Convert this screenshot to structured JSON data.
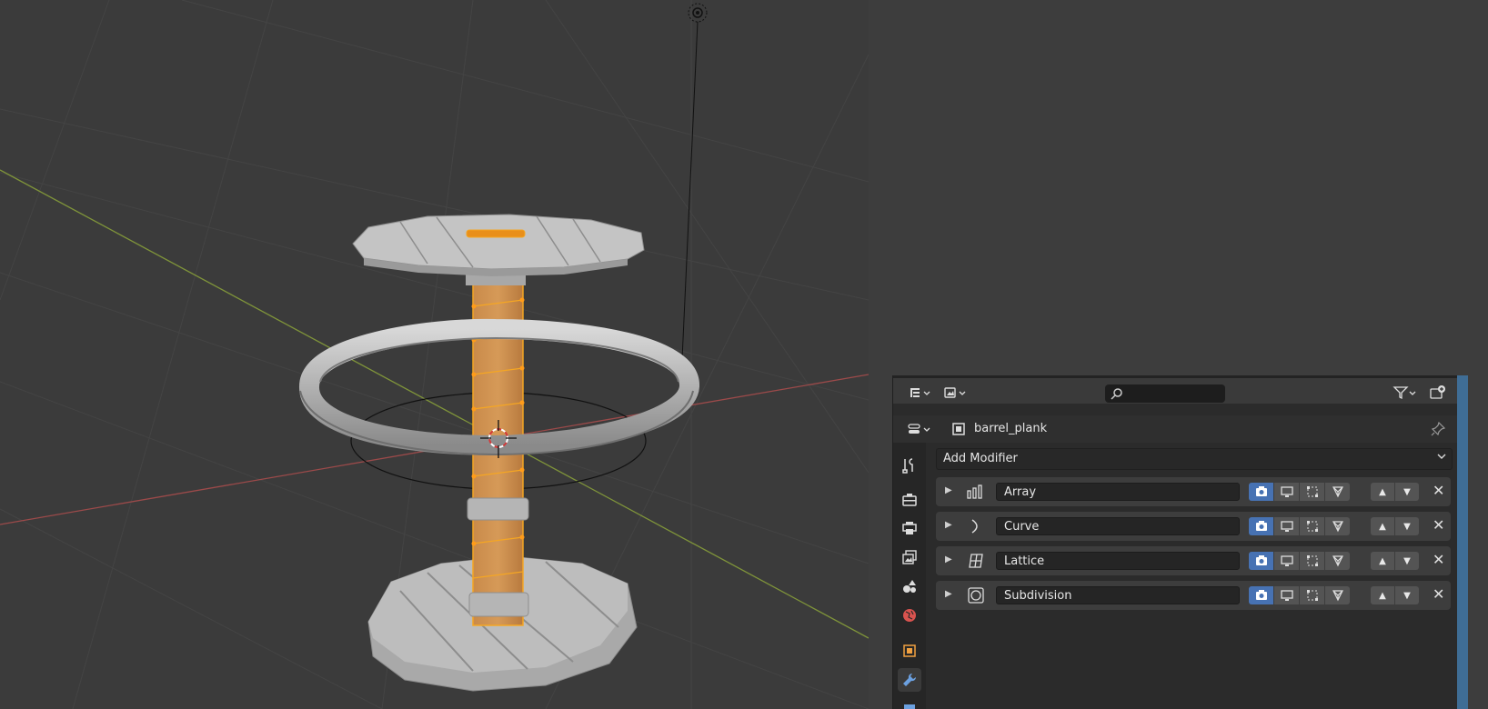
{
  "viewport": {
    "colors": {
      "background": "#3b3b3b",
      "grid": "#444444",
      "x_axis": "#9c4a4a",
      "y_axis": "#7f943a",
      "selected": "#f5a623",
      "mesh": "#b9b9b9"
    }
  },
  "properties": {
    "header": {
      "editor_type_icon": "outliner-editor-icon",
      "display_mode_icon": "display-mode-icon",
      "search": {
        "value": "",
        "placeholder": ""
      },
      "filter_icon": "filter-icon",
      "new_collection_icon": "new-collection-icon"
    },
    "object": {
      "type_icon": "object-data-icon",
      "name": "barrel_plank",
      "pin_icon": "pin-icon"
    },
    "tabs": [
      {
        "name": "tool",
        "icon": "wrench-screwdriver-icon",
        "active": false
      },
      {
        "name": "render",
        "icon": "camera-back-icon",
        "active": false
      },
      {
        "name": "output",
        "icon": "printer-icon",
        "active": false
      },
      {
        "name": "view-layer",
        "icon": "image-stack-icon",
        "active": false
      },
      {
        "name": "scene",
        "icon": "scene-icon",
        "active": false
      },
      {
        "name": "world",
        "icon": "world-icon",
        "active": false
      },
      {
        "name": "object",
        "icon": "object-square-icon",
        "active": false
      },
      {
        "name": "modifiers",
        "icon": "wrench-icon",
        "active": true
      }
    ],
    "add_modifier_label": "Add Modifier",
    "modifiers": [
      {
        "name": "Array",
        "icon": "array-icon"
      },
      {
        "name": "Curve",
        "icon": "curve-icon"
      },
      {
        "name": "Lattice",
        "icon": "lattice-icon"
      },
      {
        "name": "Subdivision",
        "icon": "subdivision-icon"
      }
    ],
    "accent": "#4772b3"
  }
}
